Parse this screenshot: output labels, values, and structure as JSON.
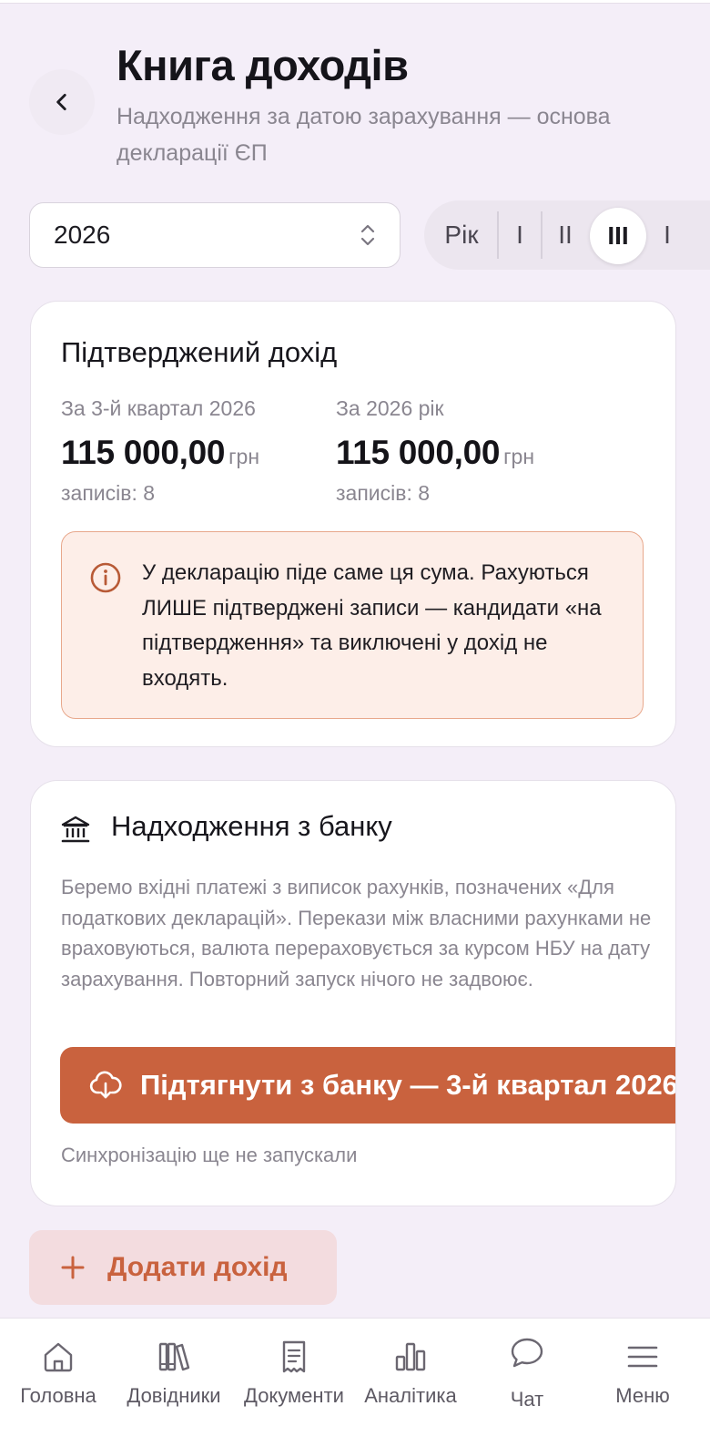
{
  "header": {
    "title": "Книга доходів",
    "subtitle": "Надходження за датою зарахування — основа декларації ЄП"
  },
  "controls": {
    "year": "2026",
    "periods": [
      "Рік",
      "I",
      "II",
      "III",
      "I"
    ],
    "selected_period": "III"
  },
  "confirmed_income": {
    "title": "Підтверджений дохід",
    "quarter": {
      "label": "За 3-й квартал 2026",
      "amount": "115 000,00",
      "unit": "грн",
      "count": "записів: 8"
    },
    "year": {
      "label": "За 2026 рік",
      "amount": "115 000,00",
      "unit": "грн",
      "count": "записів: 8"
    },
    "notice": "У декларацію піде саме ця сума. Рахуються ЛИШЕ підтверджені записи — кандидати «на підтвердження» та виключені у дохід не входять."
  },
  "bank": {
    "title": "Надходження з банку",
    "description": "Беремо вхідні платежі з виписок рахунків, позначених «Для податкових декларацій». Перекази між власними рахунками не враховуються, валюта перераховується за курсом НБУ на дату зарахування. Повторний запуск нічого не задвоює.",
    "sync_label": "Підтягнути з банку — 3-й квартал 2026",
    "sync_status": "Синхронізацію ще не запускали"
  },
  "add_income_label": "Додати дохід",
  "nav": {
    "items": [
      {
        "label": "Головна",
        "icon": "home-icon"
      },
      {
        "label": "Довідники",
        "icon": "books-icon"
      },
      {
        "label": "Документи",
        "icon": "document-icon"
      },
      {
        "label": "Аналітика",
        "icon": "bar-chart-icon"
      },
      {
        "label": "Чат",
        "icon": "chat-icon"
      },
      {
        "label": "Меню",
        "icon": "menu-icon"
      }
    ]
  },
  "colors": {
    "accent": "#c9623e",
    "background": "#f4eef8",
    "notice_bg": "#fdeee8",
    "notice_border": "#e8a88c",
    "add_button_bg": "#f3dcdf"
  }
}
